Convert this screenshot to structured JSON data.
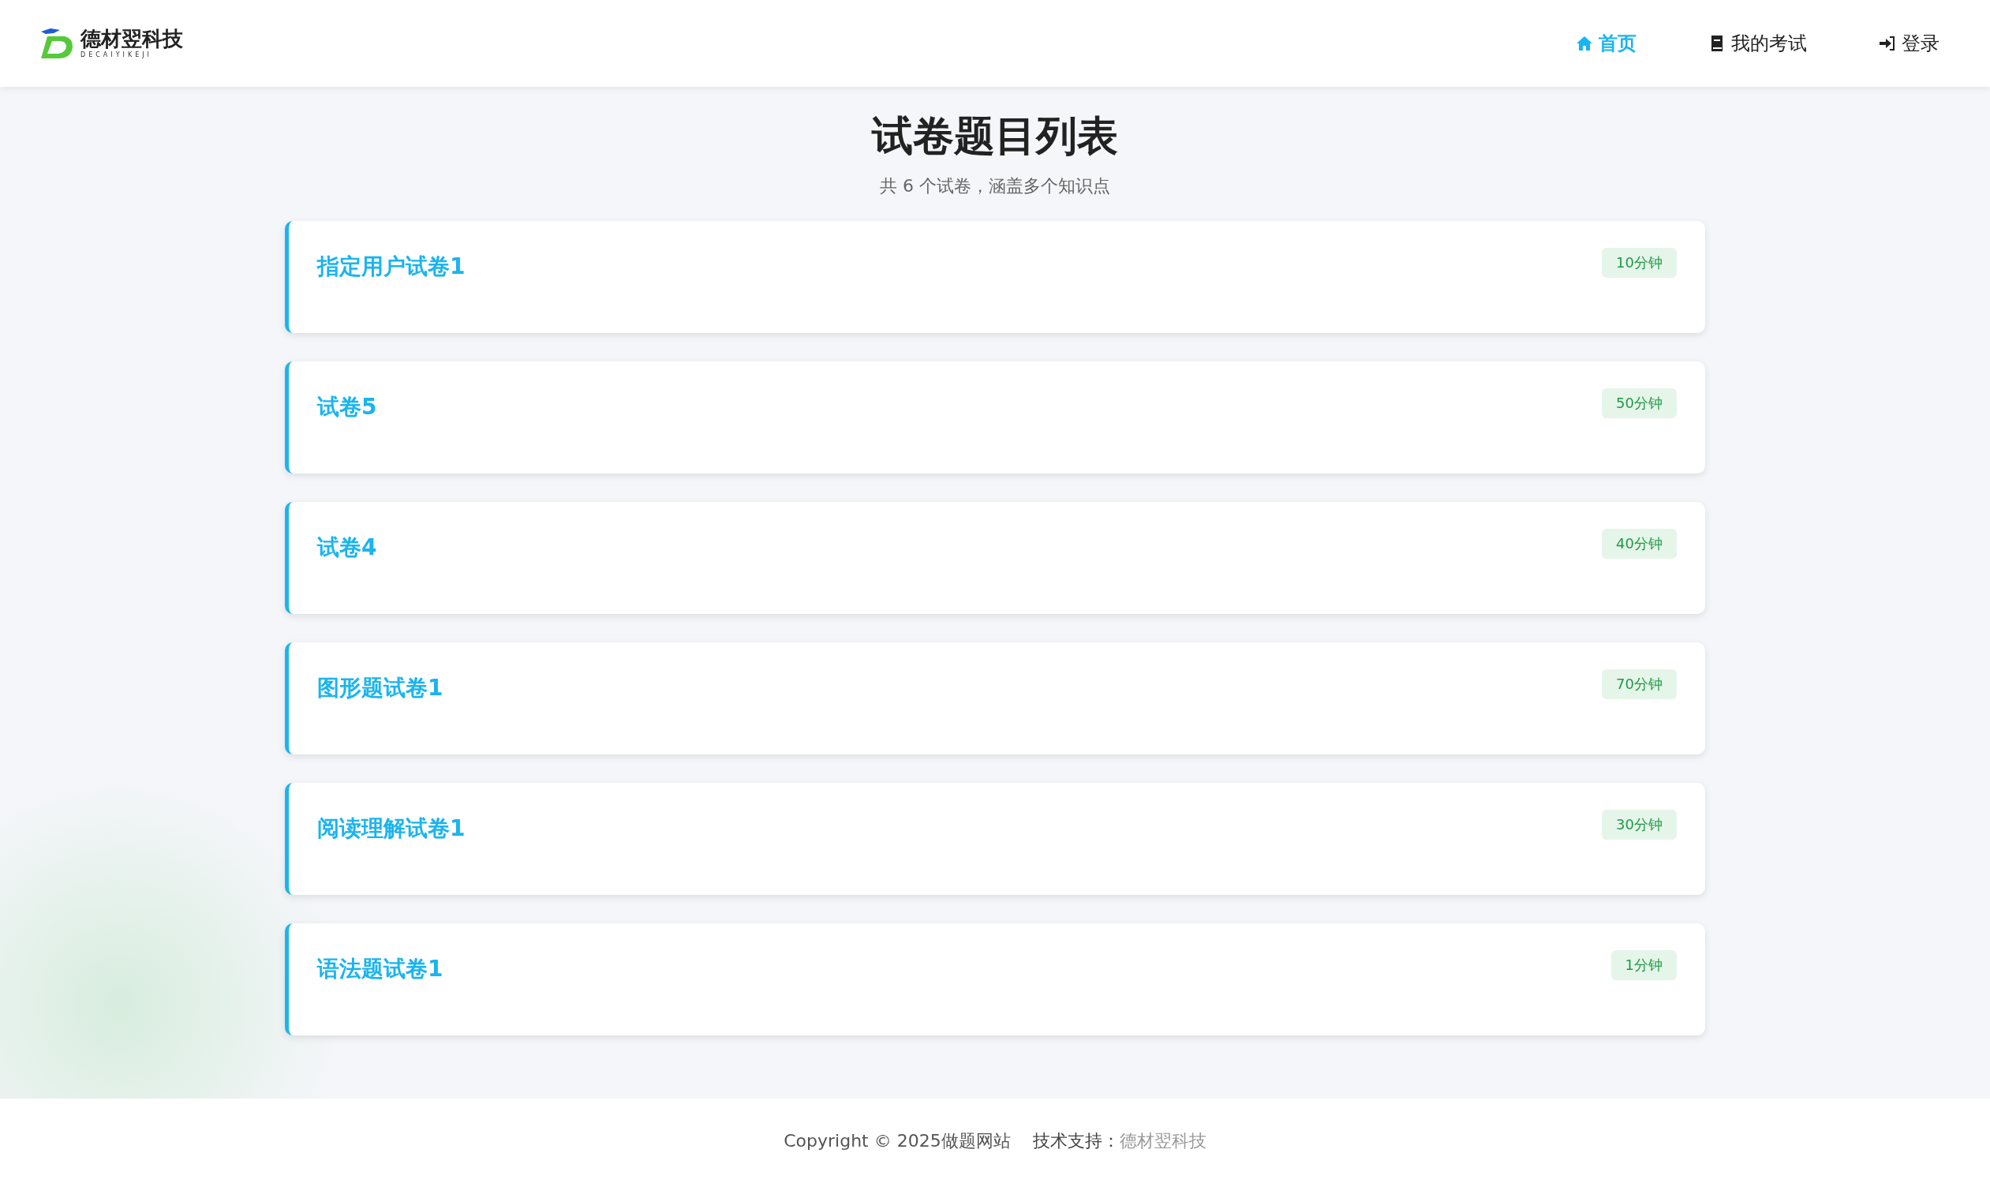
{
  "logo": {
    "name": "德材翌科技",
    "subtitle": "DECAIYIKEJI"
  },
  "nav": [
    {
      "label": "首页",
      "selected": true
    },
    {
      "label": "我的考试",
      "selected": false
    },
    {
      "label": "登录",
      "selected": false
    }
  ],
  "heading": {
    "title": "试卷题目列表",
    "subtitle": "共 6 个试卷，涵盖多个知识点"
  },
  "papers": [
    {
      "title": "指定用户试卷1",
      "duration": "10分钟"
    },
    {
      "title": "试卷5",
      "duration": "50分钟"
    },
    {
      "title": "试卷4",
      "duration": "40分钟"
    },
    {
      "title": "图形题试卷1",
      "duration": "70分钟"
    },
    {
      "title": "阅读理解试卷1",
      "duration": "30分钟"
    },
    {
      "title": "语法题试卷1",
      "duration": "1分钟"
    }
  ],
  "footer": {
    "copyright": "Copyright © 2025做题网站",
    "support_label": "技术支持：",
    "support_name": "德材翌科技"
  }
}
